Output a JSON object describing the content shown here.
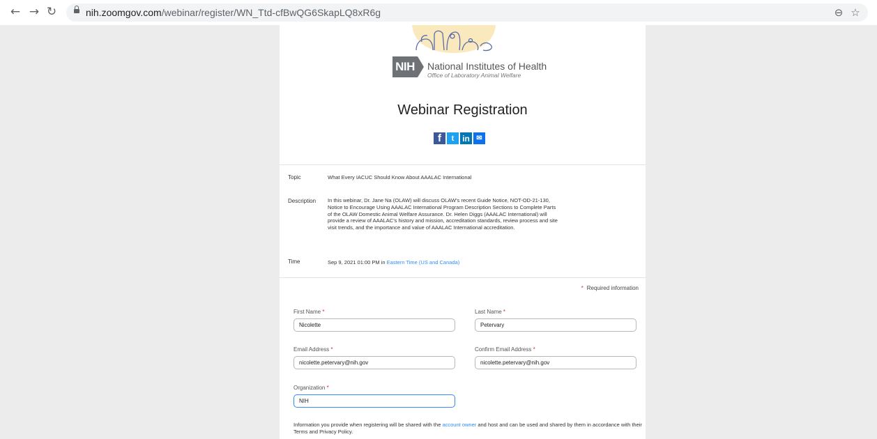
{
  "browser": {
    "url_host": "nih.zoomgov.com",
    "url_path": "/webinar/register/WN_Ttd-cfBwQG6SkapLQ8xR6g",
    "back_icon": "back-arrow-icon",
    "forward_icon": "forward-arrow-icon",
    "reload_icon": "reload-icon",
    "lock_icon": "lock-icon",
    "zoom_icon": "zoom-icon",
    "star_icon": "star-icon"
  },
  "header": {
    "org_name": "National Institutes of Health",
    "org_office": "Office of Laboratory Animal Welfare",
    "badge": "NIH",
    "title": "Webinar Registration"
  },
  "share": {
    "facebook": "f",
    "twitter": "t",
    "linkedin": "in",
    "email": "✉"
  },
  "details": {
    "topic_label": "Topic",
    "topic_value": "What Every IACUC Should Know About AAALAC International",
    "description_label": "Description",
    "description_value": "In this webinar, Dr. Jane Na (OLAW) will discuss OLAW's recent Guide Notice, NOT-OD-21-130, Notice to Encourage Using AAALAC International Program Description Sections to Complete Parts of the OLAW Domestic Animal Welfare Assurance. Dr. Helen Diggs (AAALAC International) will provide a review of AAALAC's history and mission, accreditation standards, review process and site visit trends, and the importance and value of AAALAC International accreditation.",
    "time_label": "Time",
    "time_value": "Sep 9, 2021 01:00 PM in",
    "time_zone": "Eastern Time (US and Canada)"
  },
  "form": {
    "required_note": "Required information",
    "required_star": "*",
    "first_name_label": "First Name",
    "first_name_value": "Nicolette",
    "last_name_label": "Last Name",
    "last_name_value": "Petervary",
    "email_label": "Email Address",
    "email_value": "nicolette.petervary@nih.gov",
    "confirm_email_label": "Confirm Email Address",
    "confirm_email_value": "nicolette.petervary@nih.gov",
    "organization_label": "Organization",
    "organization_value": "NIH"
  },
  "disclaimer": {
    "before": "Information you provide when registering will be shared with the",
    "link": "account owner",
    "after": "and host and can be used and shared by them in accordance with their Terms and Privacy Policy."
  },
  "colors": {
    "accent": "#2d8cff",
    "required": "#e02828",
    "nih_gray": "#6e7176"
  }
}
